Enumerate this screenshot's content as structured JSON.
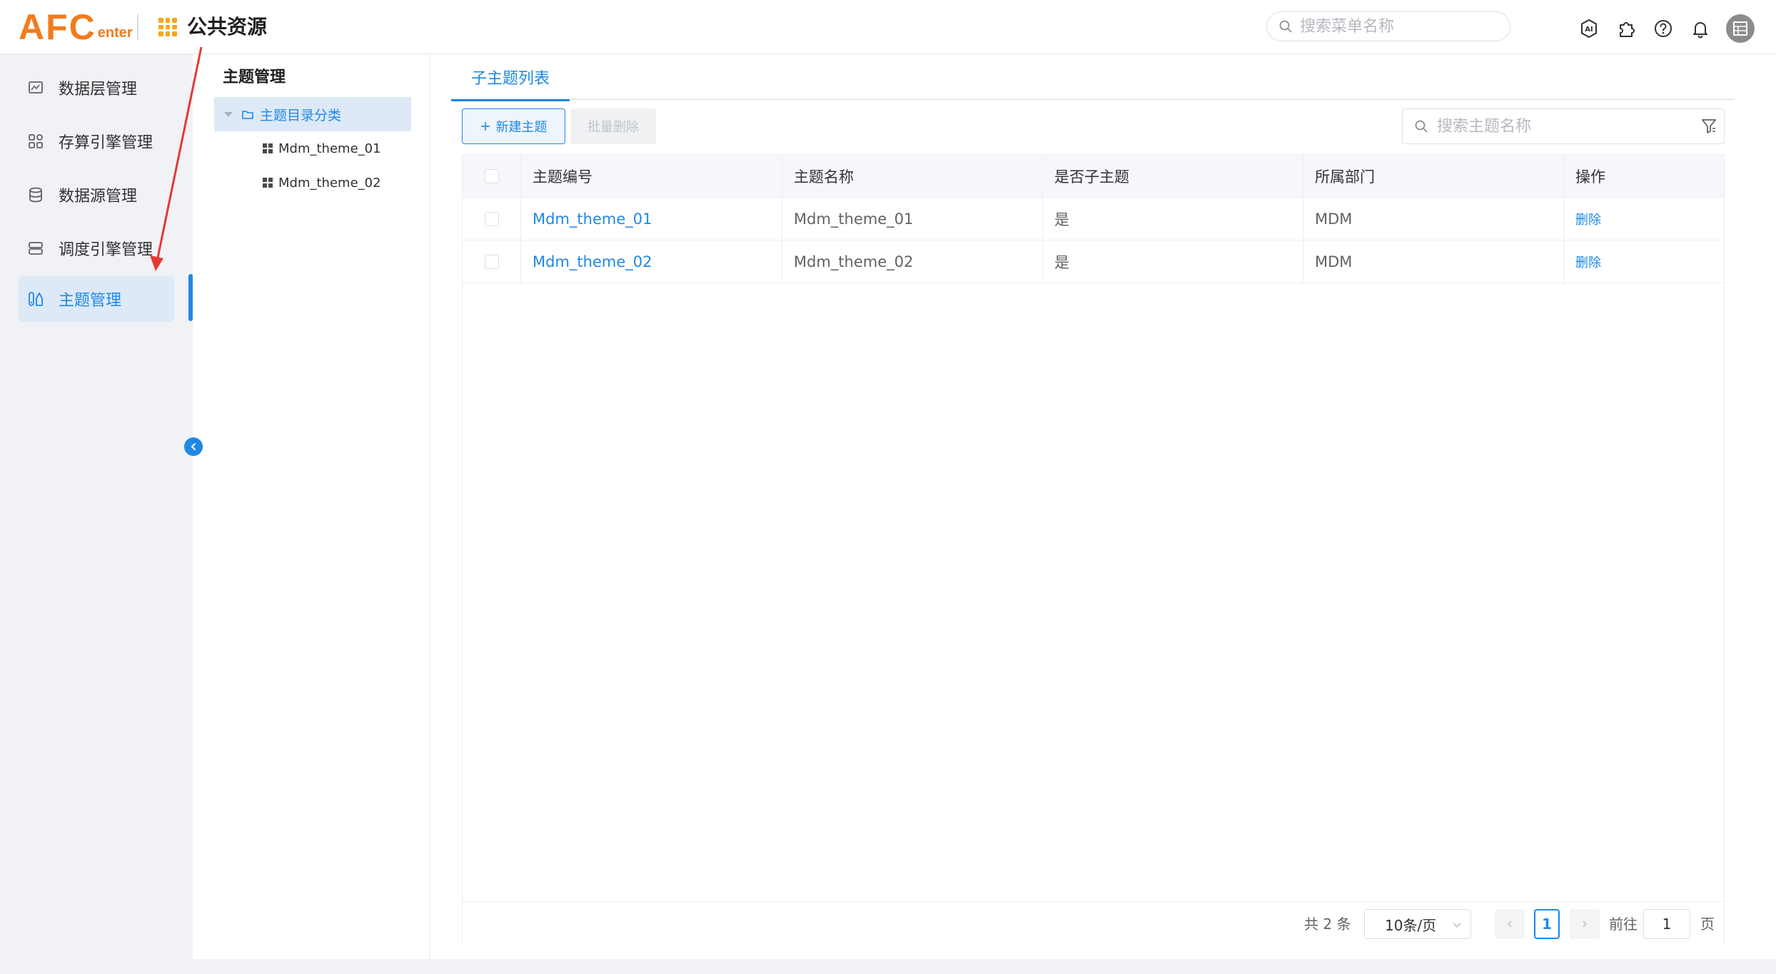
{
  "header": {
    "logo_big": "AFC",
    "logo_small": "enter",
    "app_title": "公共资源",
    "search_placeholder": "搜索菜单名称"
  },
  "sidebar": {
    "items": [
      {
        "label": "数据层管理",
        "icon": "layers-icon"
      },
      {
        "label": "存算引擎管理",
        "icon": "grid-apps-icon"
      },
      {
        "label": "数据源管理",
        "icon": "database-icon"
      },
      {
        "label": "调度引擎管理",
        "icon": "server-icon"
      },
      {
        "label": "主题管理",
        "icon": "theme-icon",
        "active": true
      }
    ]
  },
  "tree": {
    "title": "主题管理",
    "root": "主题目录分类",
    "children": [
      "Mdm_theme_01",
      "Mdm_theme_02"
    ]
  },
  "main": {
    "tab": "子主题列表",
    "new_button": "新建主题",
    "batch_delete_button": "批量删除",
    "search_placeholder": "搜索主题名称",
    "columns": [
      "主题编号",
      "主题名称",
      "是否子主题",
      "所属部门",
      "操作"
    ],
    "rows": [
      {
        "code": "Mdm_theme_01",
        "name": "Mdm_theme_01",
        "is_sub": "是",
        "dept": "MDM",
        "op": "删除"
      },
      {
        "code": "Mdm_theme_02",
        "name": "Mdm_theme_02",
        "is_sub": "是",
        "dept": "MDM",
        "op": "删除"
      }
    ],
    "pagination": {
      "total": "共 2 条",
      "page_size": "10条/页",
      "current_page": "1",
      "goto_label": "前往",
      "goto_value": "1",
      "page_suffix": "页"
    }
  },
  "colors": {
    "accent": "#1e88e5",
    "logo": "#f07c1e",
    "app_icon": "#f5a623",
    "annotation": "#e53935"
  }
}
